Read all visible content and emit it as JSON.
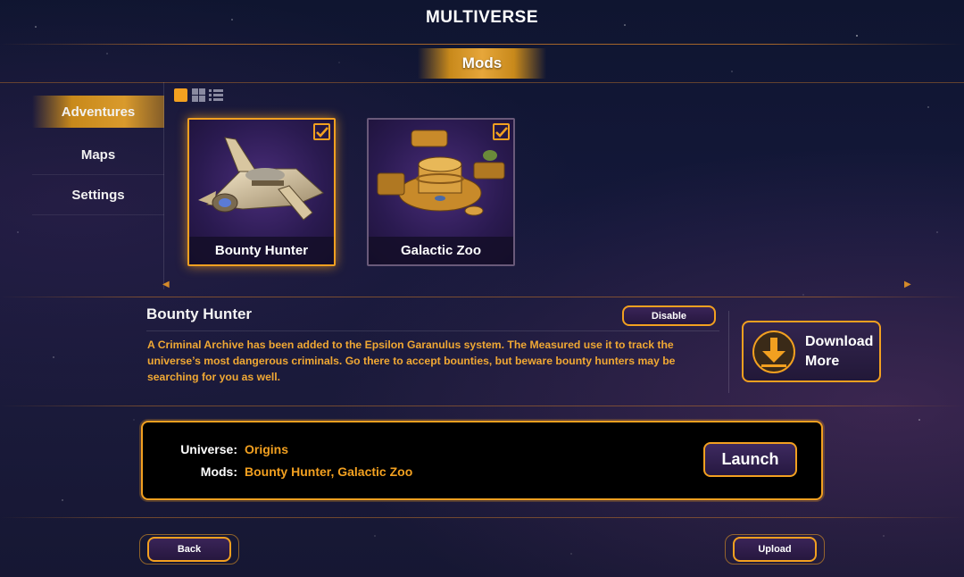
{
  "header": {
    "title": "MULTIVERSE",
    "section": "Mods"
  },
  "sidebar": {
    "items": [
      {
        "label": "Adventures",
        "active": true
      },
      {
        "label": "Maps",
        "active": false
      },
      {
        "label": "Settings",
        "active": false
      }
    ]
  },
  "view_modes": [
    "large-tile-icon",
    "small-grid-icon",
    "list-icon"
  ],
  "mods": [
    {
      "name": "Bounty Hunter",
      "selected": true,
      "checked": true
    },
    {
      "name": "Galactic Zoo",
      "selected": false,
      "checked": true
    }
  ],
  "detail": {
    "title": "Bounty Hunter",
    "toggle_label": "Disable",
    "description": "A Criminal Archive has been added to the Epsilon Garanulus system. The Measured use it to track the universe’s most dangerous criminals. Go there to accept bounties, but beware bounty hunters may be searching for you as well."
  },
  "download": {
    "line1": "Download",
    "line2": "More"
  },
  "summary": {
    "universe_label": "Universe:",
    "universe_value": "Origins",
    "mods_label": "Mods:",
    "mods_value": "Bounty Hunter, Galactic Zoo",
    "launch_label": "Launch"
  },
  "footer": {
    "back_label": "Back",
    "upload_label": "Upload"
  },
  "colors": {
    "accent": "#f2a020",
    "text_highlight": "#f0a834",
    "panel": "#26173e"
  }
}
